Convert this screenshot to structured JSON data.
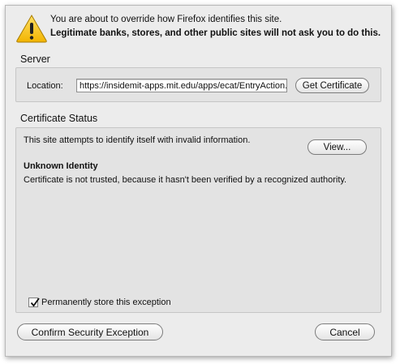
{
  "warning": {
    "icon": "warning-triangle-icon",
    "line1": "You are about to override how Firefox identifies this site.",
    "line2": "Legitimate banks, stores, and other public sites will not ask you to do this."
  },
  "server": {
    "title": "Server",
    "location_label": "Location:",
    "location_value": "https://insidemit-apps.mit.edu/apps/ecat/EntryAction.do",
    "get_certificate_label": "Get Certificate"
  },
  "certificate_status": {
    "title": "Certificate Status",
    "message": "This site attempts to identify itself with invalid information.",
    "view_label": "View...",
    "identity_heading": "Unknown Identity",
    "identity_detail": "Certificate is not trusted, because it hasn't been verified by a recognized authority.",
    "store_exception_label": "Permanently store this exception",
    "store_exception_checked": true
  },
  "buttons": {
    "confirm_label": "Confirm Security Exception",
    "cancel_label": "Cancel"
  }
}
